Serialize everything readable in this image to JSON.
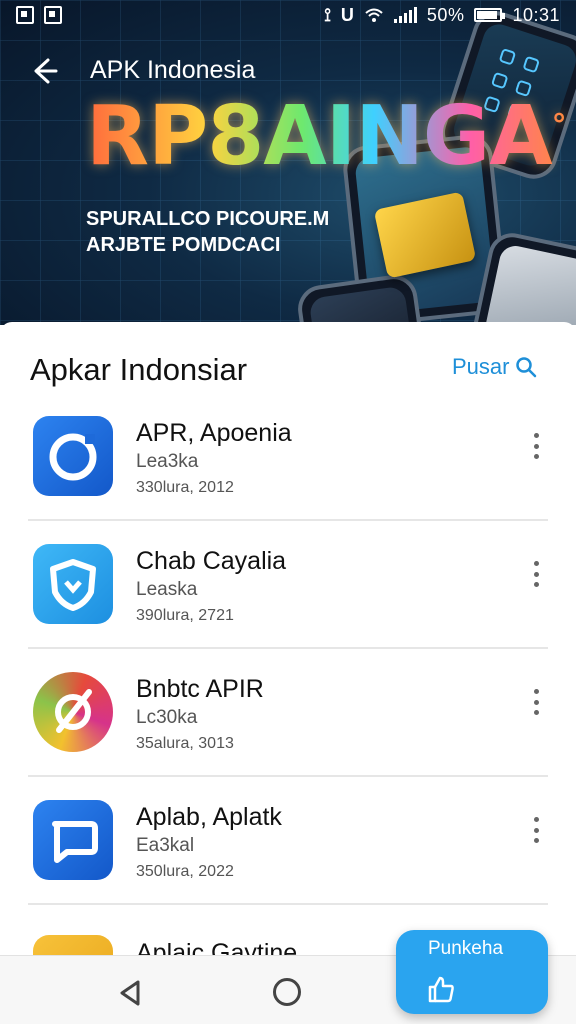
{
  "status_bar": {
    "battery_percent": "50%",
    "time": "10:31",
    "icons": [
      "screenshot-icon",
      "image-icon",
      "vibrate-icon",
      "n-icon",
      "wifi-icon",
      "signal-icon",
      "battery-icon"
    ]
  },
  "header": {
    "back_icon": "arrow-left-icon",
    "title": "APK Indonesia"
  },
  "banner": {
    "headline": "RP8AINGA",
    "headline_mark": "°",
    "tagline_line1": "SPURALLCO PICOURE.M",
    "tagline_line2": "ARJBTE POMDCACI"
  },
  "section": {
    "title": "Apkar Indonsiar",
    "action_label": "Pusar",
    "action_icon": "search-icon"
  },
  "apps": [
    {
      "name": "APR, Apoenia",
      "subtitle": "Lea3ka",
      "date": "330lura, 2012",
      "icon": "ring-app-icon",
      "color": "#1f6fe0"
    },
    {
      "name": "Chab Cayalia",
      "subtitle": "Leaska",
      "date": "390lura, 2721",
      "icon": "shield-app-icon",
      "color": "#2aa4ef"
    },
    {
      "name": "Bnbtc APIR",
      "subtitle": "Lc30ka",
      "date": "35alura, 3013",
      "icon": "slash-app-icon",
      "color": "#e64a3b"
    },
    {
      "name": "Aplab, Aplatk",
      "subtitle": "Ea3kal",
      "date": "350lura, 2022",
      "icon": "chat-app-icon",
      "color": "#1f6fe0"
    },
    {
      "name": "Aplaic Gaytine",
      "subtitle": "",
      "date": "",
      "icon": "app-icon",
      "color": "#f4b324"
    }
  ],
  "fab": {
    "label": "Punkeha",
    "icon": "thumbs-up-icon"
  },
  "nav": {
    "back_icon": "triangle-back-icon",
    "home_icon": "circle-home-icon"
  }
}
